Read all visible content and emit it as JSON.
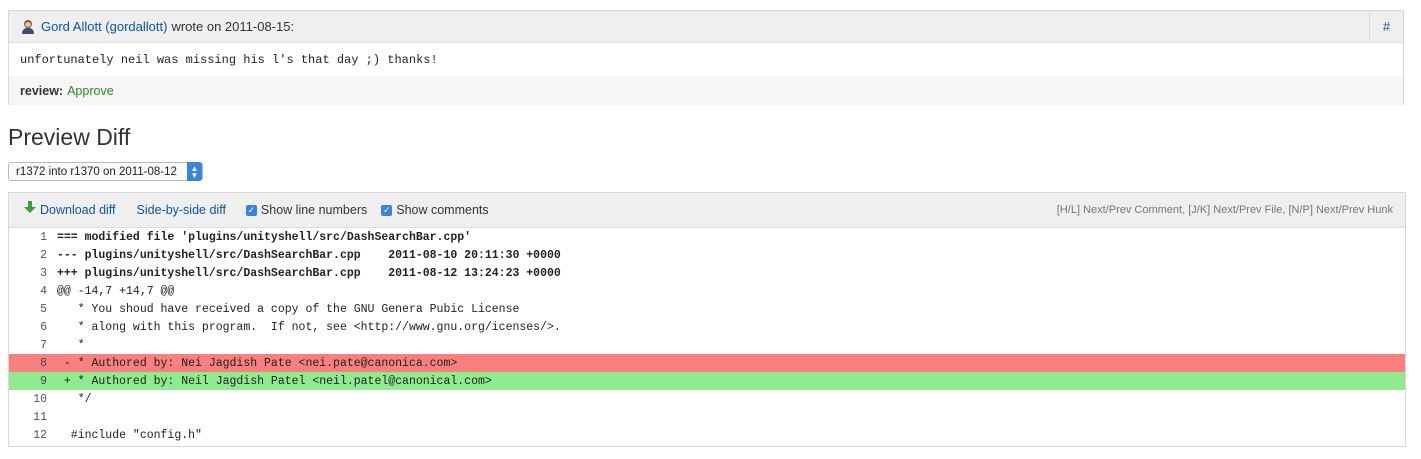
{
  "comment": {
    "author": "Gord Allott (gordallott)",
    "wrote_on": "wrote on 2011-08-15:",
    "permalink": "#",
    "body": "unfortunately neil was missing his l's that day ;) thanks!",
    "review_label": "review:",
    "review_value": "Approve"
  },
  "preview": {
    "heading": "Preview Diff",
    "revision_select": "r1372 into r1370 on 2011-08-12"
  },
  "toolbar": {
    "download_label": "Download diff",
    "side_by_side_label": "Side-by-side diff",
    "show_line_numbers_label": "Show line numbers",
    "show_comments_label": "Show comments",
    "keys_hint": "[H/L] Next/Prev Comment, [J/K] Next/Prev File, [N/P] Next/Prev Hunk"
  },
  "diff_lines": [
    {
      "num": "1",
      "text": "=== modified file 'plugins/unityshell/src/DashSearchBar.cpp'"
    },
    {
      "num": "2",
      "text": "--- plugins/unityshell/src/DashSearchBar.cpp    2011-08-10 20:11:30 +0000"
    },
    {
      "num": "3",
      "text": "+++ plugins/unityshell/src/DashSearchBar.cpp    2011-08-12 13:24:23 +0000"
    },
    {
      "num": "4",
      "text": "@@ -14,7 +14,7 @@"
    },
    {
      "num": "5",
      "text": "   * You shoud have received a copy of the GNU Genera Pubic License"
    },
    {
      "num": "6",
      "text": "   * along with this program.  If not, see <http://www.gnu.org/icenses/>."
    },
    {
      "num": "7",
      "text": "   *"
    },
    {
      "num": "8",
      "text": " - * Authored by: Nei Jagdish Pate <nei.pate@canonica.com>"
    },
    {
      "num": "9",
      "text": " + * Authored by: Neil Jagdish Patel <neil.patel@canonical.com>"
    },
    {
      "num": "10",
      "text": "   */"
    },
    {
      "num": "11",
      "text": ""
    },
    {
      "num": "12",
      "text": "  #include \"config.h\""
    }
  ]
}
